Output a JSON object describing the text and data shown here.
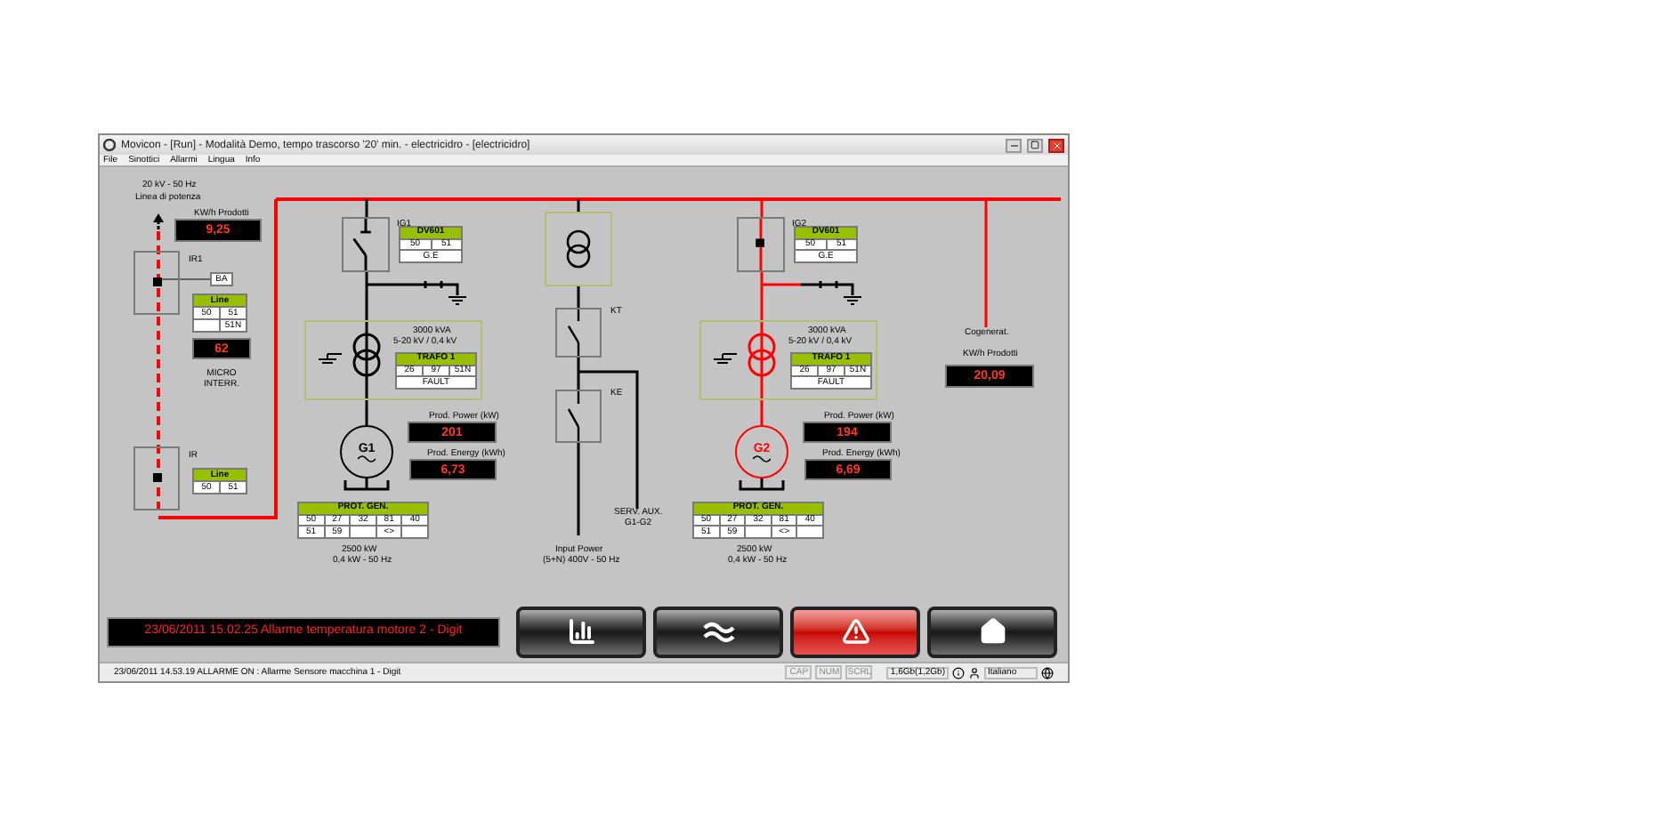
{
  "window": {
    "title": "Movicon - [Run] - Modalità Demo, tempo trascorso '20' min. - electricidro - [electricidro]"
  },
  "menu": [
    "File",
    "Sinottici",
    "Allarmi",
    "Lingua",
    "Info"
  ],
  "line_panel": {
    "supply": "20 kV - 50 Hz",
    "line_name": "Linea di potenza",
    "meter_label": "KW/h Prodotti",
    "meter_value": "9,25",
    "breakers": [
      {
        "label": "IR1",
        "closed": true,
        "tag": "BA",
        "table": {
          "title": "Line",
          "rows": [
            [
              "50",
              "51"
            ],
            [
              null,
              "51N"
            ]
          ]
        },
        "display": "62",
        "caption": "MICRO INTERR."
      },
      {
        "label": "IR",
        "closed": true,
        "table": {
          "title": "Line",
          "rows": [
            [
              "50",
              "51"
            ]
          ]
        }
      }
    ]
  },
  "units": [
    {
      "breaker": "IG1",
      "breaker_closed": false,
      "energized": false,
      "protection": {
        "title": "DV601",
        "rows": [
          [
            "50",
            "51"
          ],
          [
            {
              "text": "G.E",
              "colspan": 2
            }
          ]
        ]
      },
      "rating": "3000 kVA",
      "voltage": "5-20 kV / 0,4 kV",
      "trafo": {
        "title": "TRAFO 1",
        "rows": [
          [
            "26",
            "97",
            "51N"
          ],
          [
            {
              "text": "FAULT",
              "colspan": 3
            }
          ]
        ]
      },
      "generator": "G1",
      "power_label": "Prod. Power (kW)",
      "power": "201",
      "energy_label": "Prod. Energy (kWh)",
      "energy": "6,73",
      "prot": {
        "title": "PROT. GEN.",
        "rows": [
          [
            "50",
            "27",
            "32",
            "81",
            "40"
          ],
          [
            "51",
            "59",
            null,
            "<>",
            null
          ]
        ]
      },
      "gen_rating": "2500 kW",
      "gen_spec": "0,4 kW - 50 Hz"
    },
    {
      "breaker": "IG2",
      "breaker_closed": true,
      "energized": true,
      "protection": {
        "title": "DV601",
        "rows": [
          [
            "50",
            "51"
          ],
          [
            {
              "text": "G.E",
              "colspan": 2
            }
          ]
        ]
      },
      "rating": "3000 kVA",
      "voltage": "5-20 kV / 0,4 kV",
      "trafo": {
        "title": "TRAFO 1",
        "rows": [
          [
            "26",
            "97",
            "51N"
          ],
          [
            {
              "text": "FAULT",
              "colspan": 3
            }
          ]
        ]
      },
      "generator": "G2",
      "power_label": "Prod. Power (kW)",
      "power": "194",
      "energy_label": "Prod. Energy (kWh)",
      "energy": "6,69",
      "prot": {
        "title": "PROT. GEN.",
        "rows": [
          [
            "50",
            "27",
            "32",
            "81",
            "40"
          ],
          [
            "51",
            "59",
            null,
            "<>",
            null
          ]
        ]
      },
      "gen_rating": "2500 kW",
      "gen_spec": "0,4 kW - 50 Hz"
    }
  ],
  "aux": {
    "switches": [
      "KT",
      "KE"
    ],
    "input_label": "Input Power",
    "input_spec": "(5+N) 400V - 50 Hz",
    "aux_label": "SERV. AUX.",
    "aux_sub": "G1-G2"
  },
  "cogen": {
    "label": "Cogenerat.",
    "meter_label": "KW/h Prodotti",
    "value": "20,09"
  },
  "alarm_banner": "23/06/2011 15.02.25 Allarme temperatura motore 2 - Digit",
  "nav_buttons": [
    {
      "kind": "chart",
      "active": false
    },
    {
      "kind": "wave",
      "active": false
    },
    {
      "kind": "alarm",
      "active": true
    },
    {
      "kind": "home",
      "active": false
    }
  ],
  "status_bar": {
    "message": "23/06/2011 14.53.19 ALLARME ON : Allarme Sensore macchina 1 - Digit",
    "indicators": [
      {
        "label": "CAP",
        "on": false
      },
      {
        "label": "NUM",
        "on": false
      },
      {
        "label": "SCRL",
        "on": false
      }
    ],
    "memory": "1,6Gb(1,2Gb)",
    "language": "Italiano"
  }
}
